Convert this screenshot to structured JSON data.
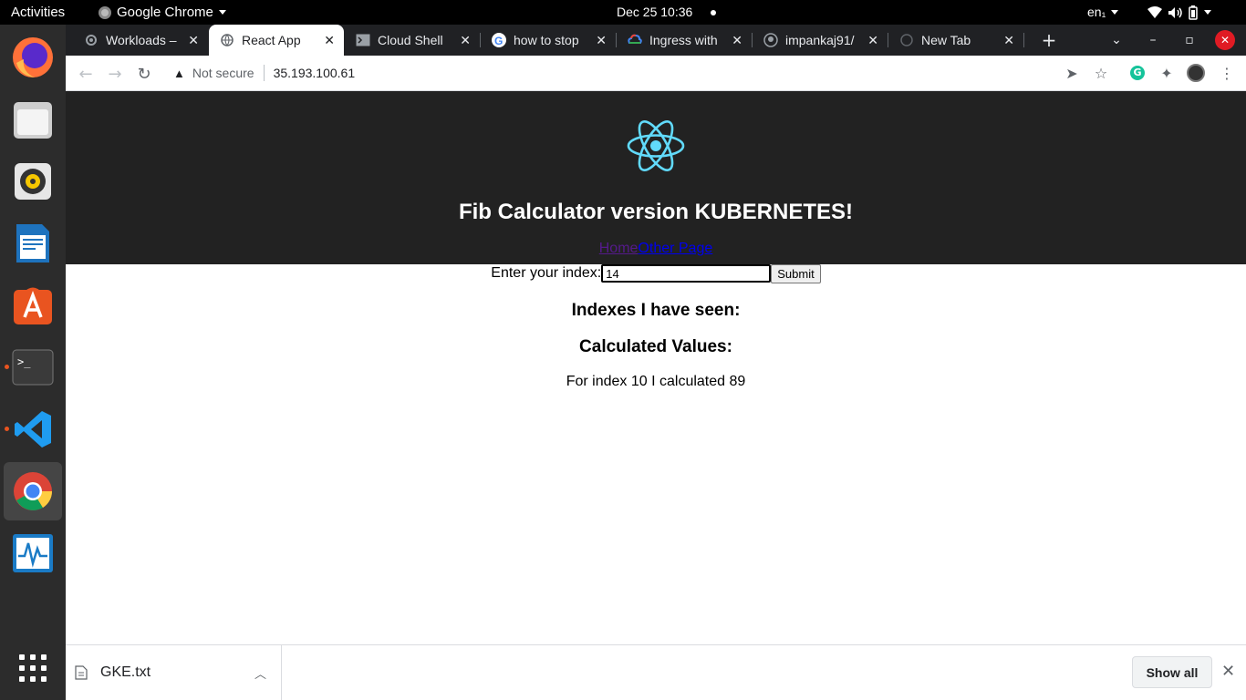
{
  "topbar": {
    "activities": "Activities",
    "app_menu": "Google Chrome",
    "clock": "Dec 25  10:36",
    "lang": "en₁"
  },
  "dock": {
    "items": [
      "firefox-icon",
      "files-icon",
      "rhythmbox-icon",
      "libreoffice-writer-icon",
      "ubuntu-software-icon",
      "terminal-icon",
      "vscode-icon",
      "chrome-icon",
      "system-monitor-icon",
      "show-apps-icon"
    ]
  },
  "tabs": [
    {
      "title": "Workloads –",
      "favicon": "gear-icon"
    },
    {
      "title": "React App",
      "favicon": "globe-icon"
    },
    {
      "title": "Cloud Shell",
      "favicon": "terminal-icon"
    },
    {
      "title": "how to stop",
      "favicon": "google-icon"
    },
    {
      "title": "Ingress with",
      "favicon": "gcp-icon"
    },
    {
      "title": "impankaj91/",
      "favicon": "github-icon"
    },
    {
      "title": "New Tab",
      "favicon": "globe-icon"
    }
  ],
  "omnibox": {
    "security": "Not secure",
    "url": "35.193.100.61"
  },
  "app": {
    "title": "Fib Calculator version KUBERNETES!",
    "nav_home": "Home",
    "nav_other": "Other Page",
    "input_label": "Enter your index:",
    "input_value": "14",
    "submit_label": "Submit",
    "indexes_title": "Indexes I have seen:",
    "calc_title": "Calculated Values:",
    "calc_line": "For index 10 I calculated 89"
  },
  "downloads": {
    "file_name": "GKE.txt",
    "show_all": "Show all"
  },
  "colors": {
    "header_bg": "#222222",
    "react_blue": "#61dafb",
    "dock_bg": "#2c2c2c",
    "tabstrip_bg": "#202124"
  }
}
